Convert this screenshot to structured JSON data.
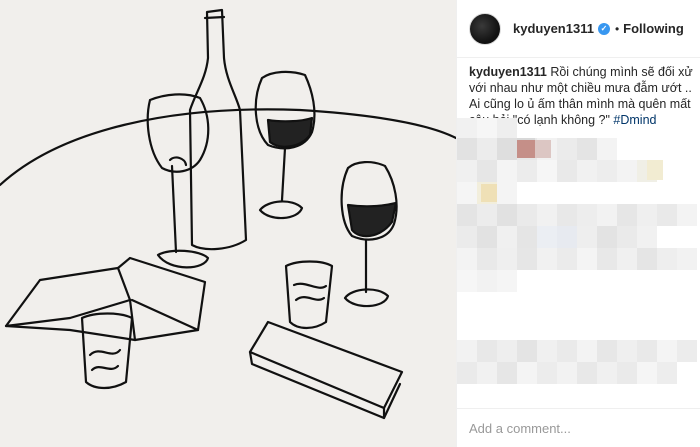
{
  "post": {
    "username": "kyduyen1311",
    "follow_status": "Following",
    "separator": "•",
    "verified_mark": "✓",
    "caption_user": "kyduyen1311",
    "caption_text": " Rồi chúng mình sẽ đối xử với nhau như một chiều mưa đẫm ướt .. Ai cũng lo ủ ấm thân mình mà quên mất câu hỏi \"có lạnh không ?\" ",
    "hashtag": "#Dmind"
  },
  "comment_box": {
    "placeholder": "Add a comment..."
  },
  "colors": {
    "link": "#003569",
    "verified": "#3897f0",
    "border": "#efefef",
    "photo_background": "#f1efec"
  },
  "icons": {
    "verified": "verified-badge-icon"
  }
}
